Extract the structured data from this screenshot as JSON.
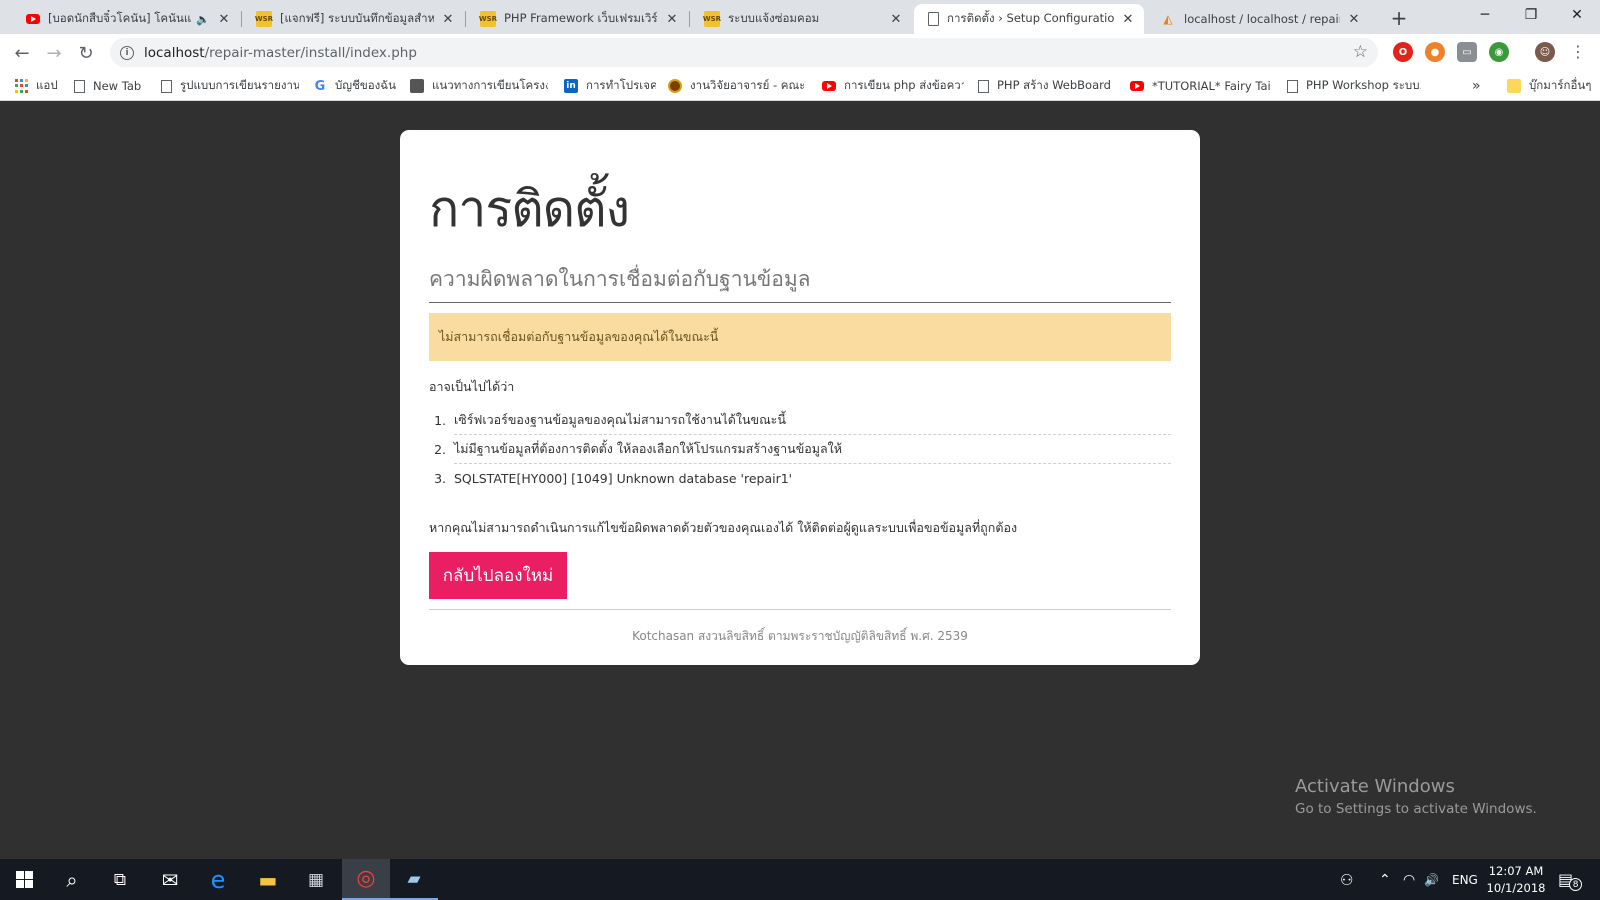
{
  "browser": {
    "tabs": [
      {
        "title": "[บอดนักสืบจิ๋วโคนัน] โคนันและ...",
        "favicon": "youtube-icon",
        "active": false,
        "audio": true
      },
      {
        "title": "[แจกฟรี] ระบบบันทึกข้อมูลสำหรับร้าน...",
        "favicon": "wsr-icon",
        "active": false,
        "audio": false
      },
      {
        "title": "PHP Framework เว็บเฟรมเวิร์ค โค...",
        "favicon": "wsr-icon",
        "active": false,
        "audio": false
      },
      {
        "title": "ระบบแจ้งซ่อมคอม",
        "favicon": "wsr-icon",
        "active": false,
        "audio": false
      },
      {
        "title": "การติดตั้ง › Setup Configuration",
        "favicon": "page-icon",
        "active": true,
        "audio": false
      },
      {
        "title": "localhost / localhost / repair | p...",
        "favicon": "phpmyadmin-icon",
        "active": false,
        "audio": false
      }
    ],
    "favicon_labels": {
      "wsr": "WSR",
      "pma": "◭"
    },
    "close_glyph": "✕",
    "audio_glyph": "🔈",
    "new_tab_glyph": "+",
    "window_controls": {
      "minimize": "─",
      "maximize": "❐",
      "close": "✕"
    },
    "nav": {
      "back": "←",
      "forward": "→",
      "reload": "↻"
    },
    "url": {
      "host": "localhost",
      "path": "/repair-master/install/index.php",
      "info_glyph": "i",
      "star_glyph": "☆"
    },
    "menu_glyph": "⋮",
    "extensions": [
      {
        "name": "opera-icon",
        "color": "#e2231a",
        "glyph": "O"
      },
      {
        "name": "basketball-icon",
        "color": "#f0812b",
        "glyph": "●"
      },
      {
        "name": "chat-icon",
        "color": "#8a8f96",
        "glyph": "▭"
      },
      {
        "name": "globe-icon",
        "color": "#3a9a3a",
        "glyph": "◉"
      },
      {
        "name": "profile-avatar-icon",
        "color": "#7a5a4a",
        "glyph": "☺"
      }
    ]
  },
  "bookmarks": {
    "items": [
      {
        "label": "แอป",
        "icon": "apps-icon"
      },
      {
        "label": "New Tab",
        "icon": "page-icon"
      },
      {
        "label": "รูปแบบการเขียนรายงาน...",
        "icon": "page-icon"
      },
      {
        "label": "บัญชีของฉัน",
        "icon": "google-icon"
      },
      {
        "label": "แนวทางการเขียนโครงงาน...",
        "icon": "image-icon"
      },
      {
        "label": "การทำโปรเจค",
        "icon": "linkedin-icon"
      },
      {
        "label": "งานวิจัยอาจารย์ - คณะวิ...",
        "icon": "seal-icon"
      },
      {
        "label": "การเขียน php ส่งข้อควา...",
        "icon": "youtube-icon"
      },
      {
        "label": "PHP สร้าง WebBoard ...",
        "icon": "page-icon"
      },
      {
        "label": "*TUTORIAL* Fairy Tail...",
        "icon": "youtube-icon"
      },
      {
        "label": "PHP Workshop ระบบ...",
        "icon": "page-icon"
      }
    ],
    "overflow_glyph": "»",
    "other_label": "บุ๊กมาร์กอื่นๆ",
    "icon_glyphs": {
      "google": "G",
      "linkedin": "in"
    }
  },
  "page": {
    "title": "การติดตั้ง",
    "subtitle": "ความผิดพลาดในการเชื่อมต่อกับฐานข้อมูล",
    "alert": "ไม่สามารถเชื่อมต่อกับฐานข้อมูลของคุณได้ในขณะนี้",
    "maybe_label": "อาจเป็นไปได้ว่า",
    "reasons": [
      {
        "num": "1.",
        "text": "เซิร์ฟเวอร์ของฐานข้อมูลของคุณไม่สามารถใช้งานได้ในขณะนี้"
      },
      {
        "num": "2.",
        "text": "ไม่มีฐานข้อมูลที่ต้องการติดตั้ง ให้ลองเลือกให้โปรแกรมสร้างฐานข้อมูลให้"
      },
      {
        "num": "3.",
        "text": "SQLSTATE[HY000] [1049] Unknown database 'repair1'"
      }
    ],
    "help_text": "หากคุณไม่สามารถดำเนินการแก้ไขข้อผิดพลาดด้วยตัวของคุณเองได้ ให้ติดต่อผู้ดูแลระบบเพื่อขอข้อมูลที่ถูกต้อง",
    "retry_button": "กลับไปลองใหม่",
    "footer": "Kotchasan สงวนลิขสิทธิ์ ตามพระราชบัญญัติลิขสิทธิ์ พ.ศ. 2539"
  },
  "watermark": {
    "line1": "Activate Windows",
    "line2": "Go to Settings to activate Windows."
  },
  "taskbar": {
    "apps": [
      {
        "name": "start-button",
        "glyph": ""
      },
      {
        "name": "search-icon",
        "glyph": "⌕"
      },
      {
        "name": "task-view-icon",
        "glyph": "⧉"
      },
      {
        "name": "mail-icon",
        "glyph": "✉"
      },
      {
        "name": "edge-icon",
        "glyph": "e"
      },
      {
        "name": "file-explorer-icon",
        "glyph": "▬"
      },
      {
        "name": "store-icon",
        "glyph": "▦"
      },
      {
        "name": "chrome-icon",
        "glyph": "◎"
      },
      {
        "name": "notepad-icon",
        "glyph": "▰"
      }
    ],
    "tray": {
      "people_glyph": "⚇",
      "chevron_glyph": "⌃",
      "wifi_glyph": "◠",
      "volume_glyph": "🔊",
      "language": "ENG",
      "time": "12:07 AM",
      "date": "10/1/2018",
      "notification_glyph": "▤",
      "notification_count": "8"
    }
  }
}
